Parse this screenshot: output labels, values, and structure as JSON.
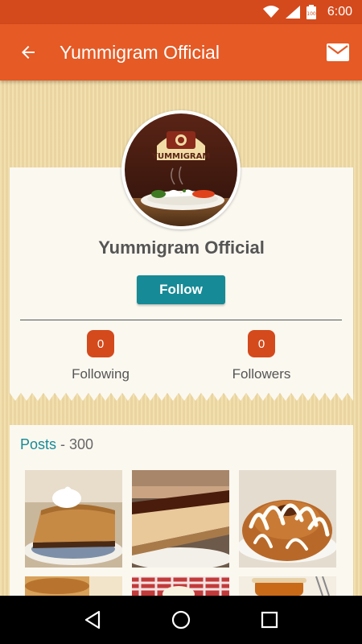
{
  "status_bar": {
    "time": "6:00",
    "icons": [
      "wifi-icon",
      "signal-icon",
      "battery-icon"
    ],
    "color": "#d44a1c"
  },
  "app_bar": {
    "title": "Yummigram Official",
    "back_icon": "arrow-left-icon",
    "mail_icon": "mail-icon",
    "color": "#e55a25"
  },
  "profile": {
    "avatar_logo_text": "YUMMIGRAM",
    "name": "Yummigram Official",
    "follow_label": "Follow",
    "follow_color": "#168a96",
    "stats": [
      {
        "count": "0",
        "label": "Following"
      },
      {
        "count": "0",
        "label": "Followers"
      }
    ],
    "badge_color": "#d44a1c"
  },
  "posts": {
    "label": "Posts",
    "separator": " - ",
    "count": "300",
    "thumbnails": [
      {
        "name": "peanut-butter-pie-thumbnail"
      },
      {
        "name": "chocolate-cheesecake-thumbnail"
      },
      {
        "name": "cinnamon-bundt-cake-thumbnail"
      },
      {
        "name": "gravy-dish-thumbnail"
      },
      {
        "name": "picnic-dessert-thumbnail"
      },
      {
        "name": "honey-jar-thumbnail"
      }
    ]
  },
  "nav_bar": {
    "buttons": [
      "back-triangle-icon",
      "home-circle-icon",
      "recents-square-icon"
    ]
  }
}
